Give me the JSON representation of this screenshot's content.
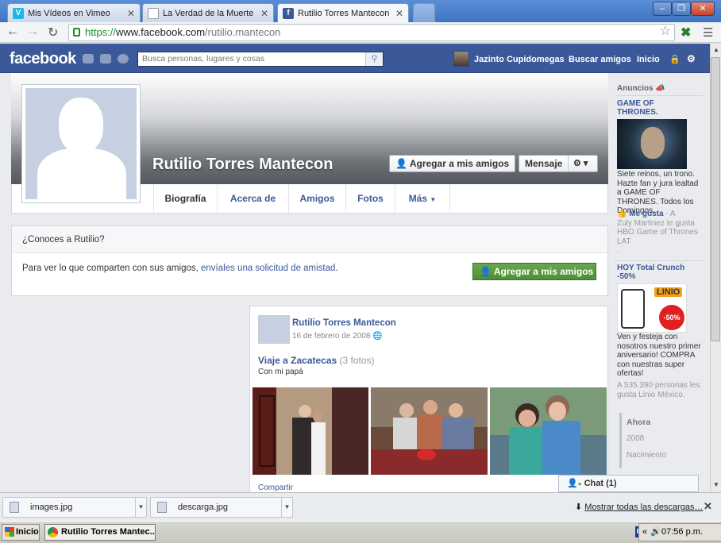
{
  "browser": {
    "tabs": [
      {
        "label": "Mis Vídeos en Vimeo",
        "icon": "vimeo-icon",
        "active": false
      },
      {
        "label": "La Verdad de la Muerte de R",
        "icon": "page-icon",
        "active": false
      },
      {
        "label": "Rutilio Torres Mantecon",
        "icon": "facebook-icon",
        "active": true
      }
    ],
    "close_glyph": "✕",
    "window_buttons": [
      "–",
      "❐",
      "✕"
    ],
    "url_scheme": "https://",
    "url_domain": "www.facebook.com",
    "url_path": "/rutilio.mantecon"
  },
  "fb_header": {
    "logo": "facebook",
    "search_placeholder": "Busca personas, lugares y cosas",
    "user_name": "Jazinto Cupidomegas",
    "find_friends": "Buscar amigos",
    "home": "Inicio",
    "brand_color": "#3b5998"
  },
  "profile": {
    "name": "Rutilio Torres Mantecon",
    "add_friend": "Agregar a mis amigos",
    "message": "Mensaje",
    "tabs": [
      "Biografía",
      "Acerca de",
      "Amigos",
      "Fotos",
      "Más"
    ]
  },
  "know": {
    "heading": "¿Conoces a Rutilio?",
    "text_prefix": "Para ver lo que comparten con sus amigos, ",
    "text_link": "envíales una solicitud de amistad",
    "text_suffix": ".",
    "button": "Agregar a mis amigos",
    "button_color": "#5b9b40"
  },
  "post": {
    "author": "Rutilio Torres Mantecon",
    "date": "16 de febrero de 2008",
    "album_title": "Viaje a Zacatecas",
    "album_count": "(3 fotos)",
    "caption": "Con mi papá",
    "share": "Compartir"
  },
  "ads": {
    "heading": "Anuncios",
    "ad1": {
      "title": "GAME OF THRONES.",
      "body": "Siete reinos, un trono. Hazte fan y jura lealtad a GAME OF THRONES. Todos los Domingos.",
      "like": "Me gusta",
      "like_sep": " · A",
      "social": "Zuly Martinez le gusta HBO Game of Thrones LAT",
      "dot": "."
    },
    "ad2": {
      "title": "HOY Total Crunch -50%",
      "brand": "LINIO",
      "discount": "-50%",
      "body": "Ven y festeja con nosotros nuestro primer aniversario! COMPRA con nuestras super ofertas!",
      "social": "A 535.390 personas les gusta Linio México."
    }
  },
  "timeline_nav": [
    "Ahora",
    "2008",
    "Nacimiento"
  ],
  "chat": {
    "label": "Chat (1)"
  },
  "downloads": {
    "items": [
      "images.jpg",
      "descarga.jpg"
    ],
    "show_all": "Mostrar todas las descargas…",
    "close": "✕"
  },
  "taskbar": {
    "start": "Inicio",
    "task": "Rutilio Torres Mantec...",
    "lang": "ES",
    "chevron": "«",
    "time": "07:56 p.m."
  }
}
